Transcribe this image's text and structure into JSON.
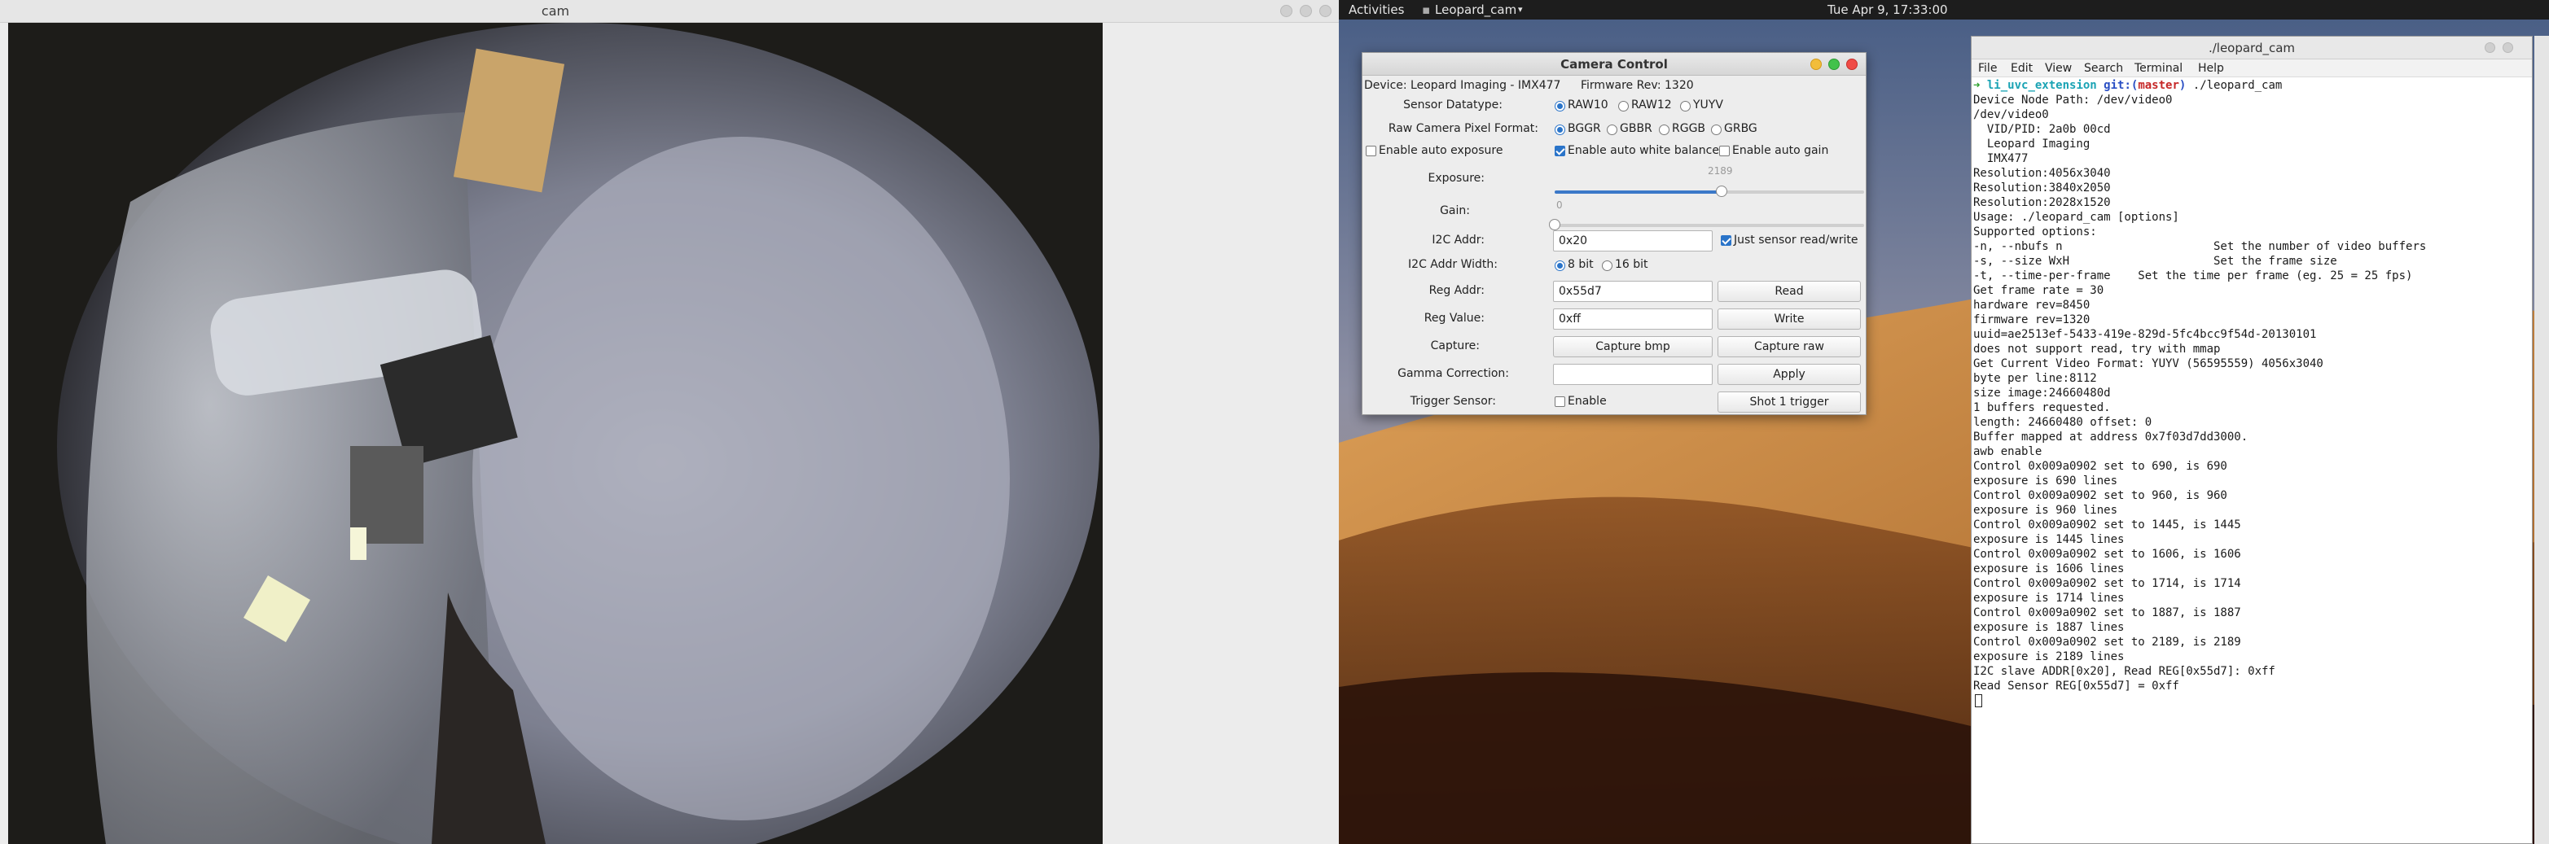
{
  "cam_window": {
    "title": "cam"
  },
  "topbar": {
    "activities": "Activities",
    "app_name": "Leopard_cam",
    "clock": "Tue Apr  9, 17:33:00"
  },
  "camera_control": {
    "title": "Camera Control",
    "device": "Device: Leopard Imaging - IMX477",
    "firmware": "Firmware Rev: 1320",
    "sensor_datatype": {
      "label": "Sensor Datatype:",
      "options": [
        "RAW10",
        "RAW12",
        "YUYV"
      ],
      "selected": "RAW10"
    },
    "pixel_format": {
      "label": "Raw Camera Pixel Format:",
      "options": [
        "BGGR",
        "GBBR",
        "RGGB",
        "GRBG"
      ],
      "selected": "BGGR"
    },
    "auto_exposure": {
      "label": "Enable auto exposure",
      "checked": false
    },
    "auto_white_balance": {
      "label": "Enable auto white balance",
      "checked": true
    },
    "auto_gain": {
      "label": "Enable auto gain",
      "checked": false
    },
    "exposure": {
      "label": "Exposure:",
      "value": "2189",
      "fraction": 0.54
    },
    "gain": {
      "label": "Gain:",
      "value": "0",
      "fraction": 0.0
    },
    "i2c_addr": {
      "label": "I2C Addr:",
      "value": "0x20",
      "just_sensor_label": "Just sensor read/write",
      "just_sensor_checked": true
    },
    "i2c_width": {
      "label": "I2C Addr Width:",
      "options": [
        "8 bit",
        "16 bit"
      ],
      "selected": "8 bit"
    },
    "reg_addr": {
      "label": "Reg Addr:",
      "value": "0x55d7",
      "button": "Read"
    },
    "reg_value": {
      "label": "Reg Value:",
      "value": "0xff",
      "button": "Write"
    },
    "capture": {
      "label": "Capture:",
      "bmp_button": "Capture bmp",
      "raw_button": "Capture raw"
    },
    "gamma": {
      "label": "Gamma Correction:",
      "value": "",
      "button": "Apply"
    },
    "trigger": {
      "label": "Trigger Sensor:",
      "enable_label": "Enable",
      "enable_checked": false,
      "button": "Shot 1 trigger"
    }
  },
  "terminal": {
    "title": "./leopard_cam",
    "menu": [
      "File",
      "Edit",
      "View",
      "Search",
      "Terminal",
      "Help"
    ],
    "prompt": {
      "arrow": "➜",
      "dir": "li_uvc_extension",
      "git": "git:(",
      "branch": "master",
      "close": ")",
      "command": " ./leopard_cam"
    },
    "lines": [
      "Device Node Path: /dev/video0",
      "/dev/video0",
      "  VID/PID: 2a0b 00cd",
      "  Leopard Imaging",
      "  IMX477",
      "Resolution:4056x3040",
      "Resolution:3840x2050",
      "Resolution:2028x1520",
      "Usage: ./leopard_cam [options]",
      "Supported options:",
      "-n, --nbufs n                      Set the number of video buffers",
      "-s, --size WxH                     Set the frame size",
      "-t, --time-per-frame    Set the time per frame (eg. 25 = 25 fps)",
      "Get frame rate = 30",
      "hardware rev=8450",
      "firmware rev=1320",
      "uuid=ae2513ef-5433-419e-829d-5fc4bcc9f54d-20130101",
      "does not support read, try with mmap",
      "Get Current Video Format: YUYV (56595559) 4056x3040",
      "byte per line:8112",
      "size image:24660480d",
      "1 buffers requested.",
      "length: 24660480 offset: 0",
      "Buffer mapped at address 0x7f03d7dd3000.",
      "awb enable",
      "Control 0x009a0902 set to 690, is 690",
      "exposure is 690 lines",
      "Control 0x009a0902 set to 960, is 960",
      "exposure is 960 lines",
      "Control 0x009a0902 set to 1445, is 1445",
      "exposure is 1445 lines",
      "Control 0x009a0902 set to 1606, is 1606",
      "exposure is 1606 lines",
      "Control 0x009a0902 set to 1714, is 1714",
      "exposure is 1714 lines",
      "Control 0x009a0902 set to 1887, is 1887",
      "exposure is 1887 lines",
      "Control 0x009a0902 set to 2189, is 2189",
      "exposure is 2189 lines",
      "I2C slave ADDR[0x20], Read REG[0x55d7]: 0xff",
      "Read Sensor REG[0x55d7] = 0xff"
    ]
  }
}
